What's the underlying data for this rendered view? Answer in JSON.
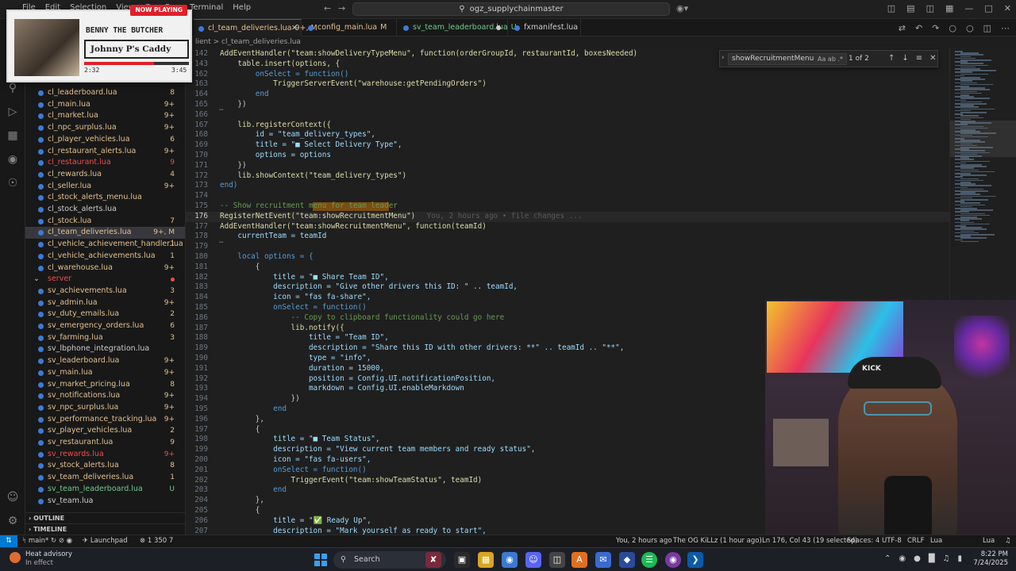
{
  "window": {
    "menu": [
      "File",
      "Edit",
      "Selection",
      "View",
      "Go",
      "Run",
      "Terminal",
      "Help"
    ],
    "search": "ogz_supplychainmaster"
  },
  "activity_icons": [
    "explorer-icon",
    "search-icon",
    "source-control-icon",
    "run-debug-icon",
    "extensions-icon",
    "remote-explorer-icon",
    "accounts-icon",
    "settings-gear-icon"
  ],
  "sidebar": {
    "files_client": [
      {
        "name": "cl_leaderboard.lua",
        "badge": "8",
        "color": "#e2c08d",
        "badge_color": "#e2c08d"
      },
      {
        "name": "cl_main.lua",
        "badge": "9+",
        "color": "#e2c08d",
        "badge_color": "#e2c08d"
      },
      {
        "name": "cl_market.lua",
        "badge": "9+",
        "color": "#e2c08d",
        "badge_color": "#e2c08d"
      },
      {
        "name": "cl_npc_surplus.lua",
        "badge": "9+",
        "color": "#e2c08d",
        "badge_color": "#e2c08d"
      },
      {
        "name": "cl_player_vehicles.lua",
        "badge": "6",
        "color": "#e2c08d",
        "badge_color": "#e2c08d"
      },
      {
        "name": "cl_restaurant_alerts.lua",
        "badge": "9+",
        "color": "#e2c08d",
        "badge_color": "#e2c08d"
      },
      {
        "name": "cl_restaurant.lua",
        "badge": "9",
        "color": "#f14c4c",
        "badge_color": "#f14c4c"
      },
      {
        "name": "cl_rewards.lua",
        "badge": "4",
        "color": "#e2c08d",
        "badge_color": "#e2c08d"
      },
      {
        "name": "cl_seller.lua",
        "badge": "9+",
        "color": "#e2c08d",
        "badge_color": "#e2c08d"
      },
      {
        "name": "cl_stock_alerts_menu.lua",
        "badge": "",
        "color": "#e2c08d",
        "badge_color": "#e2c08d"
      },
      {
        "name": "cl_stock_alerts.lua",
        "badge": "",
        "color": "#cccccc",
        "badge_color": "#cccccc"
      },
      {
        "name": "cl_stock.lua",
        "badge": "7",
        "color": "#e2c08d",
        "badge_color": "#e2c08d"
      },
      {
        "name": "cl_team_deliveries.lua",
        "badge": "9+, M",
        "color": "#e2c08d",
        "badge_color": "#e2c08d"
      },
      {
        "name": "cl_vehicle_achievement_handler.lua",
        "badge": "1",
        "color": "#e2c08d",
        "badge_color": "#e2c08d"
      },
      {
        "name": "cl_vehicle_achievements.lua",
        "badge": "1",
        "color": "#e2c08d",
        "badge_color": "#e2c08d"
      },
      {
        "name": "cl_warehouse.lua",
        "badge": "9+",
        "color": "#e2c08d",
        "badge_color": "#e2c08d"
      }
    ],
    "server_folder": "server",
    "files_server": [
      {
        "name": "sv_achievements.lua",
        "badge": "3",
        "color": "#e2c08d",
        "badge_color": "#e2c08d"
      },
      {
        "name": "sv_admin.lua",
        "badge": "9+",
        "color": "#e2c08d",
        "badge_color": "#e2c08d"
      },
      {
        "name": "sv_duty_emails.lua",
        "badge": "2",
        "color": "#e2c08d",
        "badge_color": "#e2c08d"
      },
      {
        "name": "sv_emergency_orders.lua",
        "badge": "6",
        "color": "#e2c08d",
        "badge_color": "#e2c08d"
      },
      {
        "name": "sv_farming.lua",
        "badge": "3",
        "color": "#e2c08d",
        "badge_color": "#e2c08d"
      },
      {
        "name": "sv_lbphone_integration.lua",
        "badge": "",
        "color": "#cccccc",
        "badge_color": "#cccccc"
      },
      {
        "name": "sv_leaderboard.lua",
        "badge": "9+",
        "color": "#e2c08d",
        "badge_color": "#e2c08d"
      },
      {
        "name": "sv_main.lua",
        "badge": "9+",
        "color": "#e2c08d",
        "badge_color": "#e2c08d"
      },
      {
        "name": "sv_market_pricing.lua",
        "badge": "8",
        "color": "#e2c08d",
        "badge_color": "#e2c08d"
      },
      {
        "name": "sv_notifications.lua",
        "badge": "9+",
        "color": "#e2c08d",
        "badge_color": "#e2c08d"
      },
      {
        "name": "sv_npc_surplus.lua",
        "badge": "9+",
        "color": "#e2c08d",
        "badge_color": "#e2c08d"
      },
      {
        "name": "sv_performance_tracking.lua",
        "badge": "9+",
        "color": "#e2c08d",
        "badge_color": "#e2c08d"
      },
      {
        "name": "sv_player_vehicles.lua",
        "badge": "2",
        "color": "#e2c08d",
        "badge_color": "#e2c08d"
      },
      {
        "name": "sv_restaurant.lua",
        "badge": "9",
        "color": "#e2c08d",
        "badge_color": "#e2c08d"
      },
      {
        "name": "sv_rewards.lua",
        "badge": "9+",
        "color": "#f14c4c",
        "badge_color": "#f14c4c"
      },
      {
        "name": "sv_stock_alerts.lua",
        "badge": "8",
        "color": "#e2c08d",
        "badge_color": "#e2c08d"
      },
      {
        "name": "sv_team_deliveries.lua",
        "badge": "1",
        "color": "#e2c08d",
        "badge_color": "#e2c08d"
      },
      {
        "name": "sv_team_leaderboard.lua",
        "badge": "U",
        "color": "#73c991",
        "badge_color": "#73c991"
      },
      {
        "name": "sv_team.lua",
        "badge": "",
        "color": "#cccccc",
        "badge_color": "#cccccc"
      }
    ],
    "outline": "OUTLINE",
    "timeline": "TIMELINE"
  },
  "tabs": [
    {
      "name": "cl_team_deliveries.lua",
      "suffix": "9+, M",
      "active": true,
      "color": "#e2c08d"
    },
    {
      "name": "config_main.lua",
      "suffix": "M",
      "active": false,
      "color": "#e2c08d"
    },
    {
      "name": "sv_team_leaderboard.lua",
      "suffix": "U",
      "active": false,
      "color": "#73c991"
    },
    {
      "name": "fxmanifest.lua",
      "suffix": "",
      "active": false,
      "color": "#cccccc"
    }
  ],
  "breadcrumb": "lient  >  cl_team_deliveries.lua",
  "find": {
    "query": "showRecruitmentMenu",
    "count": "1 of 2",
    "options": "Aa  ab  .*"
  },
  "code_lines": [
    {
      "n": "142",
      "t": "AddEventHandler(\"team:showDeliveryTypeMenu\", function(orderGroupId, restaurantId, boxesNeeded)"
    },
    {
      "n": "143",
      "t": "    table.insert(options, {"
    },
    {
      "n": "162",
      "t": "        onSelect = function()"
    },
    {
      "n": "163",
      "t": "            TriggerServerEvent(\"warehouse:getPendingOrders\")"
    },
    {
      "n": "164",
      "t": "        end"
    },
    {
      "n": "165",
      "t": "    })"
    },
    {
      "n": "166",
      "t": ""
    },
    {
      "n": "167",
      "t": "    lib.registerContext({"
    },
    {
      "n": "168",
      "t": "        id = \"team_delivery_types\","
    },
    {
      "n": "169",
      "t": "        title = \"■ Select Delivery Type\","
    },
    {
      "n": "170",
      "t": "        options = options"
    },
    {
      "n": "171",
      "t": "    })"
    },
    {
      "n": "172",
      "t": "    lib.showContext(\"team_delivery_types\")"
    },
    {
      "n": "173",
      "t": "end)"
    },
    {
      "n": "174",
      "t": ""
    },
    {
      "n": "175",
      "t": "-- Show recruitment menu for team leader"
    },
    {
      "n": "176",
      "t": "RegisterNetEvent(\"team:showRecruitmentMenu\")",
      "blame": "      You, 2 hours ago • file changes ..."
    },
    {
      "n": "177",
      "t": "AddEventHandler(\"team:showRecruitmentMenu\", function(teamId)"
    },
    {
      "n": "178",
      "t": "    currentTeam = teamId"
    },
    {
      "n": "179",
      "t": ""
    },
    {
      "n": "180",
      "t": "    local options = {"
    },
    {
      "n": "181",
      "t": "        {"
    },
    {
      "n": "182",
      "t": "            title = \"■ Share Team ID\","
    },
    {
      "n": "183",
      "t": "            description = \"Give other drivers this ID: \" .. teamId,"
    },
    {
      "n": "184",
      "t": "            icon = \"fas fa-share\","
    },
    {
      "n": "185",
      "t": "            onSelect = function()"
    },
    {
      "n": "186",
      "t": "                -- Copy to clipboard functionality could go here"
    },
    {
      "n": "187",
      "t": "                lib.notify({"
    },
    {
      "n": "188",
      "t": "                    title = \"Team ID\","
    },
    {
      "n": "189",
      "t": "                    description = \"Share this ID with other drivers: **\" .. teamId .. \"**\","
    },
    {
      "n": "190",
      "t": "                    type = \"info\","
    },
    {
      "n": "191",
      "t": "                    duration = 15000,"
    },
    {
      "n": "192",
      "t": "                    position = Config.UI.notificationPosition,"
    },
    {
      "n": "193",
      "t": "                    markdown = Config.UI.enableMarkdown"
    },
    {
      "n": "194",
      "t": "                })"
    },
    {
      "n": "195",
      "t": "            end"
    },
    {
      "n": "196",
      "t": "        },"
    },
    {
      "n": "197",
      "t": "        {"
    },
    {
      "n": "198",
      "t": "            title = \"■ Team Status\","
    },
    {
      "n": "199",
      "t": "            description = \"View current team members and ready status\","
    },
    {
      "n": "200",
      "t": "            icon = \"fas fa-users\","
    },
    {
      "n": "201",
      "t": "            onSelect = function()"
    },
    {
      "n": "202",
      "t": "                TriggerEvent(\"team:showTeamStatus\", teamId)"
    },
    {
      "n": "203",
      "t": "            end"
    },
    {
      "n": "204",
      "t": "        },"
    },
    {
      "n": "205",
      "t": "        {"
    },
    {
      "n": "206",
      "t": "            title = \"✅ Ready Up\","
    },
    {
      "n": "207",
      "t": "            description = \"Mark yourself as ready to start\","
    }
  ],
  "statusbar": {
    "branch": "main*",
    "launchpad": "Launchpad",
    "problems": "1  350  7",
    "blame": "You, 2 hours ago",
    "commit": "The OG KiLLz (1 hour ago)",
    "position": "Ln 176, Col 43 (19 selected)",
    "spaces": "Spaces: 4",
    "encoding": "UTF-8",
    "eol": "CRLF",
    "lang1": "Lua",
    "lang2": "Lua"
  },
  "taskbar": {
    "weather_title": "Heat advisory",
    "weather_sub": "In effect",
    "search": "Search",
    "time": "8:22 PM",
    "date": "7/24/2025"
  },
  "nowplaying": {
    "badge": "NOW PLAYING",
    "artist": "BENNY THE BUTCHER",
    "title": "Johnny P's Caddy",
    "elapsed": "2:32",
    "total": "3:45",
    "progress": 0.67
  },
  "webcam": {
    "cap_text": "KICK"
  }
}
